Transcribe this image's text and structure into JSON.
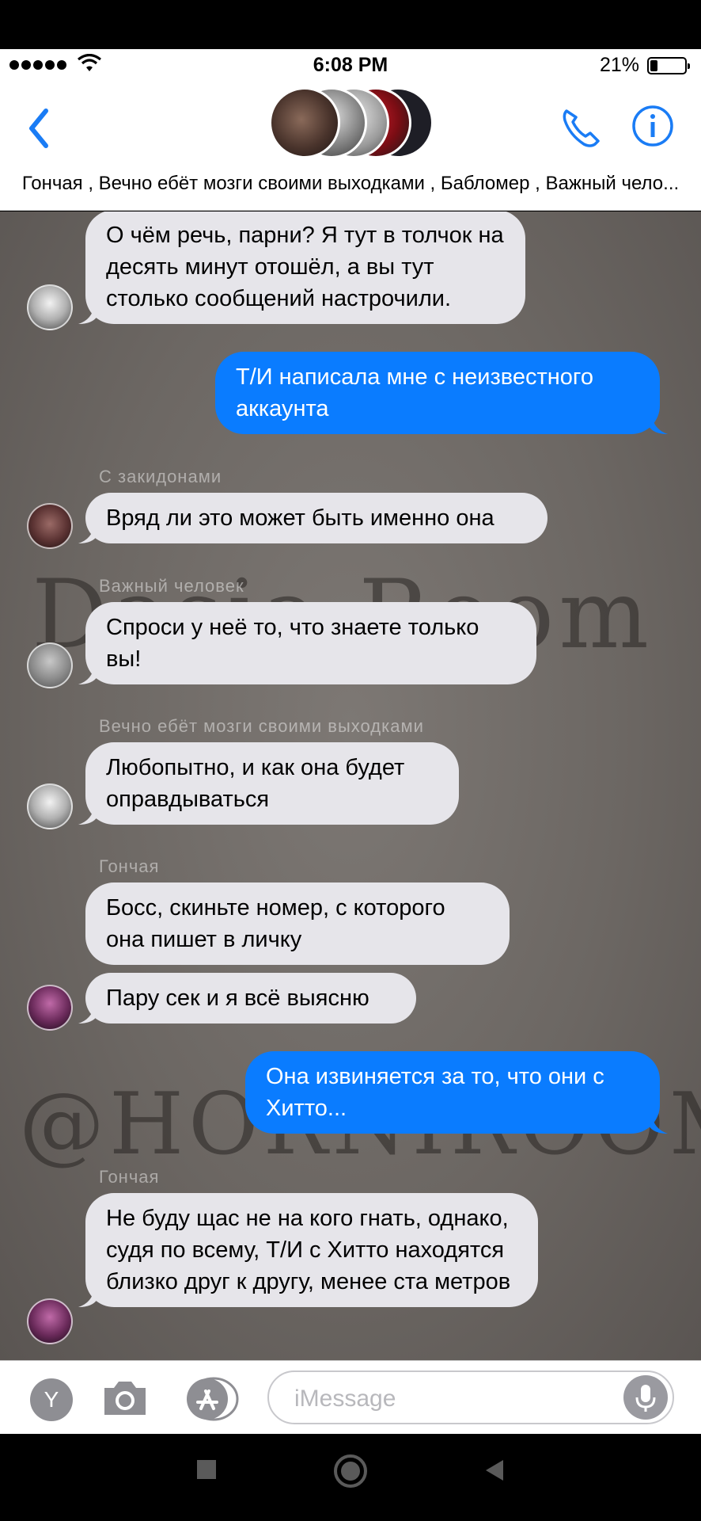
{
  "status_bar": {
    "time": "6:08 PM",
    "battery_percent_text": "21%",
    "battery_level": 0.21
  },
  "header": {
    "group_names": "Гончая , Вечно ебёт мозги своими выходками , Бабломер , Важный чело...",
    "icons": [
      "back-chevron-icon",
      "phone-icon",
      "info-icon"
    ]
  },
  "watermarks": {
    "line1": "Dasia Room",
    "line2": "@HORNIROOM"
  },
  "messages": [
    {
      "dir": "in",
      "sender": "",
      "text": "О чём речь, парни? Я тут в толчок на десять минут отошёл, а вы тут столько сообщений настрочили."
    },
    {
      "dir": "out",
      "text": "Т/И написала мне с неизвестного аккаунта"
    },
    {
      "dir": "in",
      "sender": "С закидонами",
      "text": "Вряд ли это может быть именно она"
    },
    {
      "dir": "in",
      "sender": "Важный человек",
      "text": "Спроси у неё то, что знаете только вы!"
    },
    {
      "dir": "in",
      "sender": "Вечно ебёт мозги своими выходками",
      "text": "Любопытно, и как она будет оправдываться"
    },
    {
      "dir": "in",
      "sender": "Гончая",
      "text": "Босс, скиньте номер, с которого она пишет в личку"
    },
    {
      "dir": "in",
      "sender": "",
      "text": "Пару сек и я всё выясню"
    },
    {
      "dir": "out",
      "text": "Она извиняется за то, что они с Хитто..."
    },
    {
      "dir": "in",
      "sender": "Гончая",
      "text": "Не буду щас не на кого гнать, однако, судя по всему, Т/И с Хитто находятся близко друг к другу, менее ста метров"
    }
  ],
  "input_bar": {
    "apps_button_label": "Y",
    "placeholder": "iMessage"
  },
  "colors": {
    "outgoing_bubble": "#0a7cff",
    "incoming_bubble": "#e6e5ea",
    "accent": "#1a7cf5"
  }
}
